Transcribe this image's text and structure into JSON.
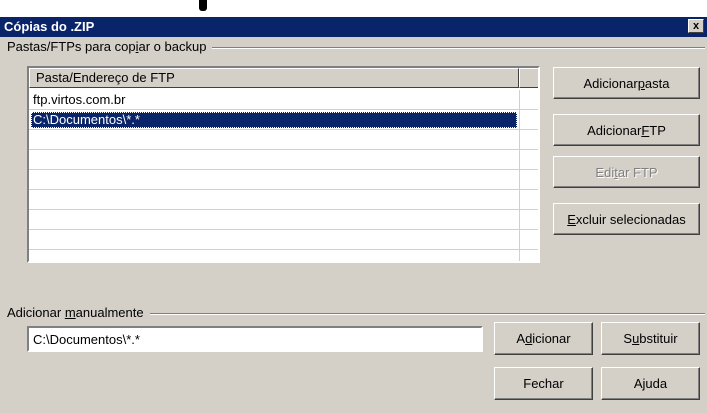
{
  "window": {
    "title": "Cópias do .ZIP",
    "close_symbol": "x"
  },
  "backup_group": {
    "label_parts": [
      "Pastas/FTPs para cop",
      "i",
      "ar o backup"
    ],
    "list": {
      "column_header": "Pasta/Endereço de FTP",
      "rows": [
        {
          "path": "ftp.virtos.com.br",
          "selected": false
        },
        {
          "path": "C:\\Documentos\\*.*",
          "selected": true
        },
        {
          "path": "",
          "selected": false
        },
        {
          "path": "",
          "selected": false
        },
        {
          "path": "",
          "selected": false
        },
        {
          "path": "",
          "selected": false
        },
        {
          "path": "",
          "selected": false
        },
        {
          "path": "",
          "selected": false
        }
      ]
    },
    "buttons": {
      "add_folder": [
        "Adicionar ",
        "p",
        "asta"
      ],
      "add_ftp": [
        "Adicionar ",
        "F",
        "TP"
      ],
      "edit_ftp": [
        "Edi",
        "t",
        "ar FTP"
      ],
      "delete_selected": [
        "",
        "E",
        "xcluir selecionadas"
      ]
    }
  },
  "manual_group": {
    "label_parts": [
      "Adicionar ",
      "m",
      "anualmente"
    ],
    "input_value": "C:\\Documentos\\*.*",
    "buttons": {
      "add": [
        "A",
        "d",
        "icionar"
      ],
      "replace": [
        "S",
        "u",
        "bstituir"
      ]
    }
  },
  "footer": {
    "close_label": "Fechar",
    "help_label": "Ajuda"
  }
}
